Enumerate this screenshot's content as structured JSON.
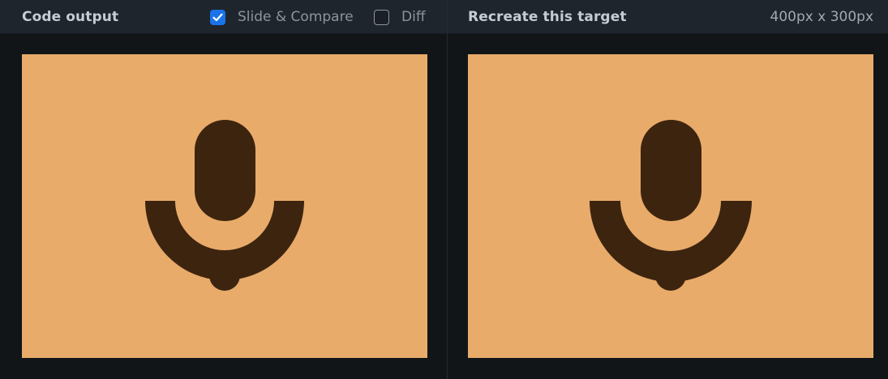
{
  "left_panel": {
    "title": "Code output",
    "slide_compare": {
      "label": "Slide & Compare",
      "checked": true
    },
    "diff": {
      "label": "Diff",
      "checked": false
    }
  },
  "right_panel": {
    "title": "Recreate this target",
    "dimensions": "400px x 300px"
  },
  "colors": {
    "canvas_background": "#e8ab6a",
    "icon_color": "#3d240f",
    "accent": "#1a73e8"
  },
  "canvas_content": {
    "icon": "microphone-icon"
  }
}
